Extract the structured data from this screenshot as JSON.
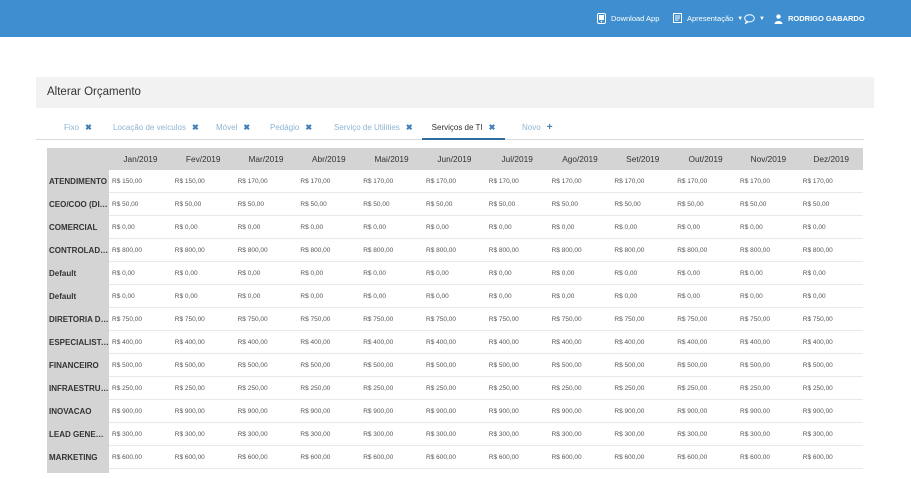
{
  "topbar": {
    "download_label": "Download App",
    "presentation_label": "Apresentação",
    "user_name": "RODRIGO GABARDO",
    "color": "#3f8ecf"
  },
  "panel": {
    "title": "Alterar Orçamento"
  },
  "tabs": [
    {
      "label": "Fixo",
      "active": false
    },
    {
      "label": "Locação de veículos",
      "active": false
    },
    {
      "label": "Móvel",
      "active": false
    },
    {
      "label": "Pedágio",
      "active": false
    },
    {
      "label": "Serviço de Utilities",
      "active": false
    },
    {
      "label": "Serviços de TI",
      "active": true
    }
  ],
  "new_tab_label": "Novo",
  "table": {
    "columns": [
      "Jan/2019",
      "Fev/2019",
      "Mar/2019",
      "Abr/2019",
      "Mai/2019",
      "Jun/2019",
      "Jul/2019",
      "Ago/2019",
      "Set/2019",
      "Out/2019",
      "Nov/2019",
      "Dez/2019"
    ],
    "rows": [
      {
        "label": "ATENDIMENTO",
        "values": [
          "R$ 150,00",
          "R$ 150,00",
          "R$ 170,00",
          "R$ 170,00",
          "R$ 170,00",
          "R$ 170,00",
          "R$ 170,00",
          "R$ 170,00",
          "R$ 170,00",
          "R$ 170,00",
          "R$ 170,00",
          "R$ 170,00"
        ]
      },
      {
        "label": "CEO/COO (DIRE...",
        "values": [
          "R$ 50,00",
          "R$ 50,00",
          "R$ 50,00",
          "R$ 50,00",
          "R$ 50,00",
          "R$ 50,00",
          "R$ 50,00",
          "R$ 50,00",
          "R$ 50,00",
          "R$ 50,00",
          "R$ 50,00",
          "R$ 50,00"
        ]
      },
      {
        "label": "COMERCIAL",
        "values": [
          "R$ 0,00",
          "R$ 0,00",
          "R$ 0,00",
          "R$ 0,00",
          "R$ 0,00",
          "R$ 0,00",
          "R$ 0,00",
          "R$ 0,00",
          "R$ 0,00",
          "R$ 0,00",
          "R$ 0,00",
          "R$ 0,00"
        ]
      },
      {
        "label": "CONTROLADOR...",
        "values": [
          "R$ 800,00",
          "R$ 800,00",
          "R$ 800,00",
          "R$ 800,00",
          "R$ 800,00",
          "R$ 800,00",
          "R$ 800,00",
          "R$ 800,00",
          "R$ 800,00",
          "R$ 800,00",
          "R$ 800,00",
          "R$ 800,00"
        ]
      },
      {
        "label": "Default",
        "values": [
          "R$ 0,00",
          "R$ 0,00",
          "R$ 0,00",
          "R$ 0,00",
          "R$ 0,00",
          "R$ 0,00",
          "R$ 0,00",
          "R$ 0,00",
          "R$ 0,00",
          "R$ 0,00",
          "R$ 0,00",
          "R$ 0,00"
        ]
      },
      {
        "label": "Default",
        "values": [
          "R$ 0,00",
          "R$ 0,00",
          "R$ 0,00",
          "R$ 0,00",
          "R$ 0,00",
          "R$ 0,00",
          "R$ 0,00",
          "R$ 0,00",
          "R$ 0,00",
          "R$ 0,00",
          "R$ 0,00",
          "R$ 0,00"
        ]
      },
      {
        "label": "DIRETORIA DE ...",
        "values": [
          "R$ 750,00",
          "R$ 750,00",
          "R$ 750,00",
          "R$ 750,00",
          "R$ 750,00",
          "R$ 750,00",
          "R$ 750,00",
          "R$ 750,00",
          "R$ 750,00",
          "R$ 750,00",
          "R$ 750,00",
          "R$ 750,00"
        ]
      },
      {
        "label": "ESPECIALISTA ...",
        "values": [
          "R$ 400,00",
          "R$ 400,00",
          "R$ 400,00",
          "R$ 400,00",
          "R$ 400,00",
          "R$ 400,00",
          "R$ 400,00",
          "R$ 400,00",
          "R$ 400,00",
          "R$ 400,00",
          "R$ 400,00",
          "R$ 400,00"
        ]
      },
      {
        "label": "FINANCEIRO",
        "values": [
          "R$ 500,00",
          "R$ 500,00",
          "R$ 500,00",
          "R$ 500,00",
          "R$ 500,00",
          "R$ 500,00",
          "R$ 500,00",
          "R$ 500,00",
          "R$ 500,00",
          "R$ 500,00",
          "R$ 500,00",
          "R$ 500,00"
        ]
      },
      {
        "label": "INFRAESTRUTU...",
        "values": [
          "R$ 250,00",
          "R$ 250,00",
          "R$ 250,00",
          "R$ 250,00",
          "R$ 250,00",
          "R$ 250,00",
          "R$ 250,00",
          "R$ 250,00",
          "R$ 250,00",
          "R$ 250,00",
          "R$ 250,00",
          "R$ 250,00"
        ]
      },
      {
        "label": "INOVACAO",
        "values": [
          "R$ 900,00",
          "R$ 900,00",
          "R$ 900,00",
          "R$ 900,00",
          "R$ 900,00",
          "R$ 900,00",
          "R$ 900,00",
          "R$ 900,00",
          "R$ 900,00",
          "R$ 900,00",
          "R$ 900,00",
          "R$ 900,00"
        ]
      },
      {
        "label": "LEAD GENERAT...",
        "values": [
          "R$ 300,00",
          "R$ 300,00",
          "R$ 300,00",
          "R$ 300,00",
          "R$ 300,00",
          "R$ 300,00",
          "R$ 300,00",
          "R$ 300,00",
          "R$ 300,00",
          "R$ 300,00",
          "R$ 300,00",
          "R$ 300,00"
        ]
      },
      {
        "label": "MARKETING",
        "values": [
          "R$ 600,00",
          "R$ 600,00",
          "R$ 600,00",
          "R$ 600,00",
          "R$ 600,00",
          "R$ 600,00",
          "R$ 600,00",
          "R$ 600,00",
          "R$ 600,00",
          "R$ 600,00",
          "R$ 600,00",
          "R$ 600,00"
        ]
      }
    ]
  }
}
